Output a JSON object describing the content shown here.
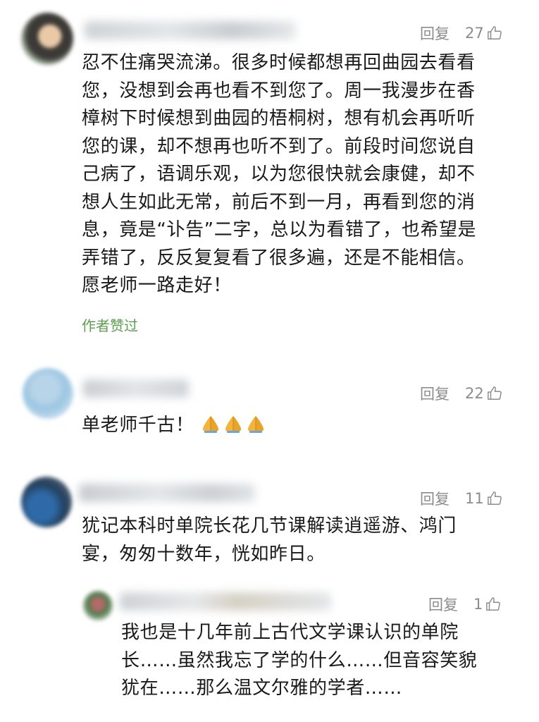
{
  "comments": [
    {
      "reply_label": "回复",
      "likes": "27",
      "lines": [
        "忍不住痛哭流涕。很多时候都想再回曲园去看看",
        "您，没想到会再也看不到您了。周一我漫步在香",
        "樟树下时候想到曲园的梧桐树，想有机会再听听",
        "您的课，却不想再也听不到了。前段时间您说自",
        "己病了，语调乐观，以为您很快就会康健，却不",
        "想人生如此无常，前后不到一月，再看到您的消",
        "息，竟是“讣告”二字，总以为看错了，也希望是",
        "弄错了，反反复复看了很多遍，还是不能相信。",
        "愿老师一路走好！"
      ],
      "author_liked": "作者赞过"
    },
    {
      "reply_label": "回复",
      "likes": "22",
      "text": "单老师千古！"
    },
    {
      "reply_label": "回复",
      "likes": "11",
      "lines": [
        "犹记本科时单院长花几节课解读逍遥游、鸿门",
        "宴，匆匆十数年，恍如昨日。"
      ],
      "reply": {
        "reply_label": "回复",
        "likes": "1",
        "lines": [
          "我也是十几年前上古代文学课认识的单院",
          "长……虽然我忘了学的什么……但音容笑貌",
          "犹在……那么温文尔雅的学者……"
        ]
      }
    }
  ],
  "icons": {
    "like": "thumbs-up-icon",
    "pray": "folded-hands-icon"
  },
  "colors": {
    "author_liked": "#5b9e4f",
    "meta": "#8c8c8c"
  }
}
